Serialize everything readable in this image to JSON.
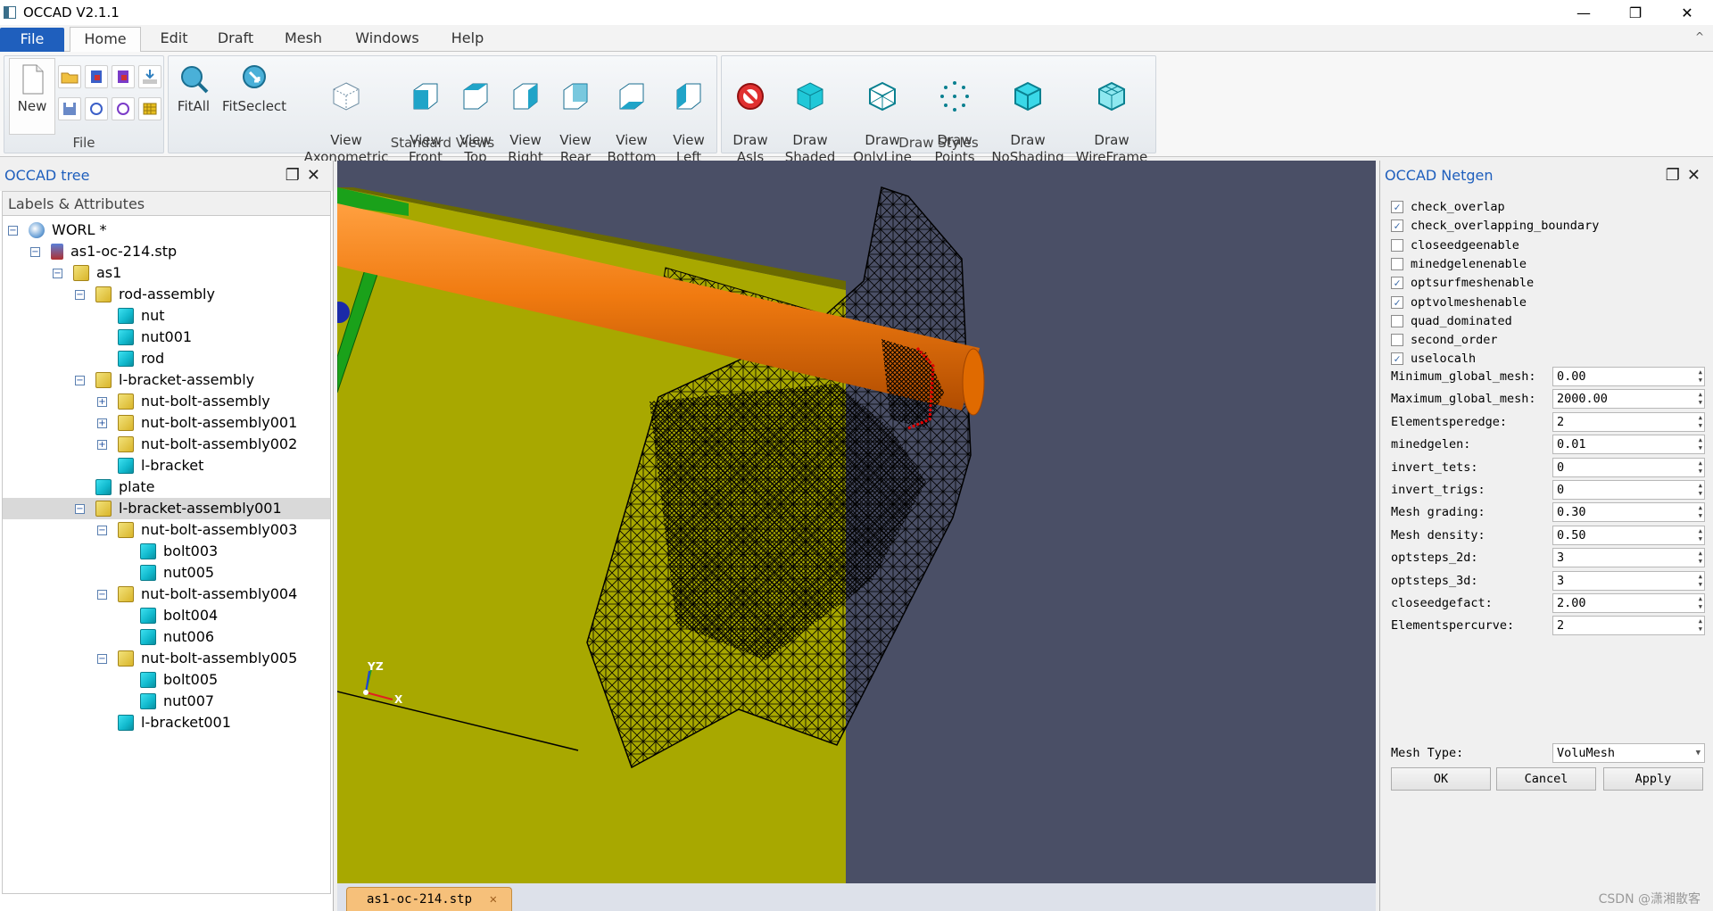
{
  "window": {
    "title": "OCCAD V2.1.1",
    "minimize": "—",
    "maximize": "❐",
    "close": "✕"
  },
  "menu": {
    "tabs": [
      "File",
      "Home",
      "Edit",
      "Draft",
      "Mesh",
      "Windows",
      "Help"
    ],
    "collapse": "^"
  },
  "ribbon": {
    "file_group": {
      "label": "File",
      "new": "New"
    },
    "views_group": {
      "label": "Standard Views",
      "buttons": [
        "FitAll",
        "FitSeclect",
        "View\nAxonometric",
        "View\nFront",
        "View\nTop",
        "View\nRight",
        "View\nRear",
        "View\nBottom",
        "View\nLeft"
      ]
    },
    "styles_group": {
      "label": "Draw Styles",
      "buttons": [
        "Draw\nAsIs",
        "Draw\nShaded",
        "Draw\nOnlyLine",
        "Draw\nPoints",
        "Draw\nNoShading",
        "Draw\nWireFrame"
      ]
    }
  },
  "tree_panel": {
    "title": "OCCAD tree",
    "header": "Labels & Attributes",
    "nodes": [
      {
        "label": "WORL *",
        "depth": 0,
        "icon": "globe-icon",
        "expander": "−"
      },
      {
        "label": "as1-oc-214.stp",
        "depth": 1,
        "icon": "file-icon",
        "expander": "−"
      },
      {
        "label": "as1",
        "depth": 2,
        "icon": "assembly-icon",
        "expander": "−"
      },
      {
        "label": "rod-assembly",
        "depth": 3,
        "icon": "assembly-icon",
        "expander": "−"
      },
      {
        "label": "nut",
        "depth": 4,
        "icon": "part-icon",
        "expander": ""
      },
      {
        "label": "nut001",
        "depth": 4,
        "icon": "part-icon",
        "expander": ""
      },
      {
        "label": "rod",
        "depth": 4,
        "icon": "part-icon",
        "expander": ""
      },
      {
        "label": "l-bracket-assembly",
        "depth": 3,
        "icon": "assembly-icon",
        "expander": "−"
      },
      {
        "label": "nut-bolt-assembly",
        "depth": 4,
        "icon": "assembly-icon",
        "expander": "+"
      },
      {
        "label": "nut-bolt-assembly001",
        "depth": 4,
        "icon": "assembly-icon",
        "expander": "+"
      },
      {
        "label": "nut-bolt-assembly002",
        "depth": 4,
        "icon": "assembly-icon",
        "expander": "+"
      },
      {
        "label": "l-bracket",
        "depth": 4,
        "icon": "part-icon",
        "expander": ""
      },
      {
        "label": "plate",
        "depth": 3,
        "icon": "part-icon",
        "expander": ""
      },
      {
        "label": "l-bracket-assembly001",
        "depth": 3,
        "icon": "assembly-icon",
        "expander": "−",
        "selected": true
      },
      {
        "label": "nut-bolt-assembly003",
        "depth": 4,
        "icon": "assembly-icon",
        "expander": "−"
      },
      {
        "label": "bolt003",
        "depth": 5,
        "icon": "part-icon",
        "expander": ""
      },
      {
        "label": "nut005",
        "depth": 5,
        "icon": "part-icon",
        "expander": ""
      },
      {
        "label": "nut-bolt-assembly004",
        "depth": 4,
        "icon": "assembly-icon",
        "expander": "−"
      },
      {
        "label": "bolt004",
        "depth": 5,
        "icon": "part-icon",
        "expander": ""
      },
      {
        "label": "nut006",
        "depth": 5,
        "icon": "part-icon",
        "expander": ""
      },
      {
        "label": "nut-bolt-assembly005",
        "depth": 4,
        "icon": "assembly-icon",
        "expander": "−"
      },
      {
        "label": "bolt005",
        "depth": 5,
        "icon": "part-icon",
        "expander": ""
      },
      {
        "label": "nut007",
        "depth": 5,
        "icon": "part-icon",
        "expander": ""
      },
      {
        "label": "l-bracket001",
        "depth": 4,
        "icon": "part-icon",
        "expander": ""
      }
    ]
  },
  "viewport": {
    "axis_label_y": "Y",
    "axis_label_z": "Z",
    "axis_label_x": "X",
    "document_tab": "as1-oc-214.stp",
    "document_tab_close": "✕"
  },
  "netgen_panel": {
    "title": "OCCAD Netgen",
    "checkboxes": [
      {
        "label": "check_overlap",
        "checked": true
      },
      {
        "label": "check_overlapping_boundary",
        "checked": true
      },
      {
        "label": "closeedgeenable",
        "checked": false
      },
      {
        "label": "minedgelenenable",
        "checked": false
      },
      {
        "label": "optsurfmeshenable",
        "checked": true
      },
      {
        "label": "optvolmeshenable",
        "checked": true
      },
      {
        "label": "quad_dominated",
        "checked": false
      },
      {
        "label": "second_order",
        "checked": false
      },
      {
        "label": "uselocalh",
        "checked": true
      }
    ],
    "fields": [
      {
        "label": "Minimum_global_mesh:",
        "value": "0.00"
      },
      {
        "label": "Maximum_global_mesh:",
        "value": "2000.00"
      },
      {
        "label": "Elementsperedge:",
        "value": "2"
      },
      {
        "label": "minedgelen:",
        "value": "0.01"
      },
      {
        "label": "invert_tets:",
        "value": "0"
      },
      {
        "label": "invert_trigs:",
        "value": "0"
      },
      {
        "label": "Mesh grading:",
        "value": "0.30"
      },
      {
        "label": "Mesh density:",
        "value": "0.50"
      },
      {
        "label": "optsteps_2d:",
        "value": "3"
      },
      {
        "label": "optsteps_3d:",
        "value": "3"
      },
      {
        "label": "closeedgefact:",
        "value": "2.00"
      },
      {
        "label": "Elementspercurve:",
        "value": "2"
      }
    ],
    "mesh_type": {
      "label": "Mesh Type:",
      "value": "VoluMesh"
    },
    "buttons": {
      "ok": "OK",
      "cancel": "Cancel",
      "apply": "Apply"
    }
  },
  "watermark": "CSDN @潇湘散客",
  "colors": {
    "file_tab": "#1f5fbd",
    "viewport_bg": "#4a4f66",
    "plate": "#a8a800",
    "rod": "#f07a10",
    "mesh": "#000000",
    "bracket_green": "#1aa11a"
  }
}
